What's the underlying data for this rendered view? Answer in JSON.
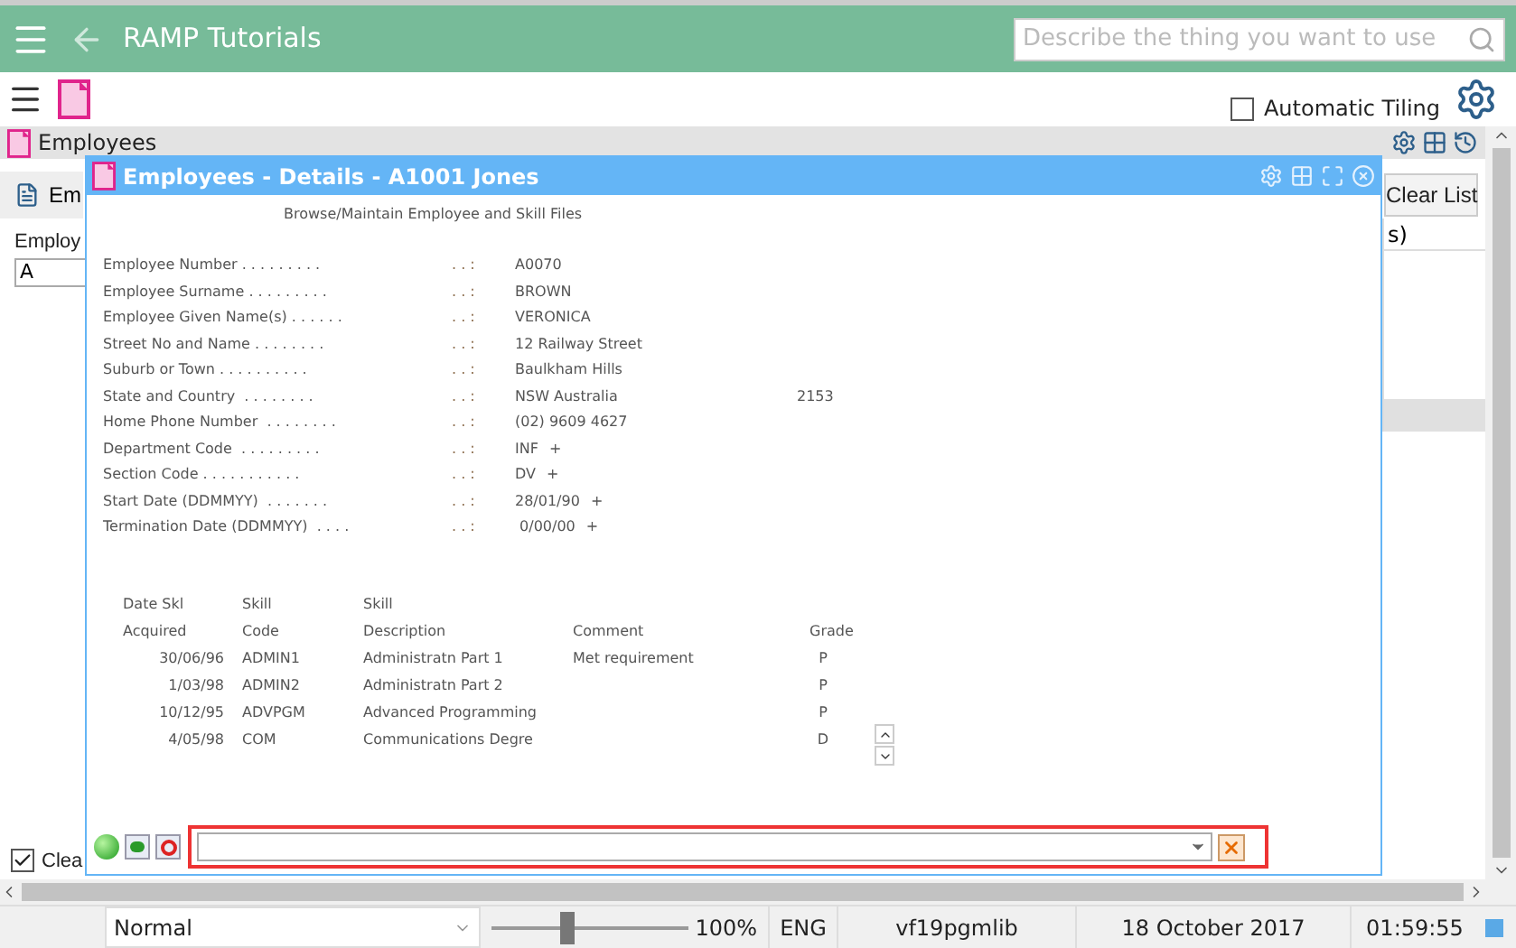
{
  "app_bar": {
    "title": "RAMP Tutorials",
    "search": {
      "placeholder": "Describe the thing you want to use"
    }
  },
  "toolbar": {
    "automatic_tiling": {
      "label": "Automatic Tiling",
      "checked": false
    }
  },
  "employees_panel": {
    "title": "Employees",
    "tab_label": "Em",
    "clear_list": "Clear List",
    "field_label": "Employ",
    "field_value": "A",
    "column_header": "s)",
    "clear_checkbox": {
      "label": "Clea",
      "checked": true
    }
  },
  "details_window": {
    "title": "Employees - Details - A1001 Jones",
    "subtitle": "Browse/Maintain Employee and Skill Files",
    "fields": [
      {
        "label": "Employee Number . . . . . . . . .",
        "separator": ". . :",
        "value": "A0070"
      },
      {
        "label": "Employee Surname . . . . . . . . .",
        "separator": ". . :",
        "value": "BROWN"
      },
      {
        "label": "Employee Given Name(s) . . . . . .",
        "separator": ". . :",
        "value": "VERONICA"
      },
      {
        "label": "Street No and Name . . . . . . . .",
        "separator": ". . :",
        "value": "12 Railway Street"
      },
      {
        "label": "Suburb or Town . . . . . . . . . .",
        "separator": ". . :",
        "value": "Baulkham Hills"
      },
      {
        "label": "State and Country  . . . . . . . .",
        "separator": ". . :",
        "value": "NSW Australia",
        "extra": "2153"
      },
      {
        "label": "Home Phone Number  . . . . . . . .",
        "separator": ". . :",
        "value": "(02) 9609 4627"
      },
      {
        "label": "Department Code  . . . . . . . . .",
        "separator": ". . :",
        "value": "INF",
        "extra": "+"
      },
      {
        "label": "Section Code . . . . . . . . . . .",
        "separator": ". . :",
        "value": "DV",
        "extra": "+"
      },
      {
        "label": "Start Date (DDMMYY)  . . . . . . .",
        "separator": ". . :",
        "value": "28/01/90",
        "extra": "+"
      },
      {
        "label": "Termination Date (DDMMYY)  . . . .",
        "separator": ". . :",
        "value": " 0/00/00",
        "extra": "+"
      }
    ],
    "skill_columns": [
      {
        "line_1": "Date Skl",
        "line_2": "Acquired"
      },
      {
        "line_1": "Skill",
        "line_2": "Code"
      },
      {
        "line_1": "Skill",
        "line_2": "Description"
      },
      {
        "line_2": "Comment"
      },
      {
        "line_2": "Grade"
      }
    ],
    "skills": [
      {
        "date": "30/06/96",
        "code": "ADMIN1",
        "description": "Administratn Part 1",
        "comment": "Met requirement",
        "grade": "P"
      },
      {
        "date": "1/03/98",
        "code": "ADMIN2",
        "description": "Administratn Part 2",
        "grade": "P"
      },
      {
        "date": "10/12/95",
        "code": "ADVPGM",
        "description": "Advanced Programming",
        "grade": "P"
      },
      {
        "date": "4/05/98",
        "code": "COM",
        "description": "Communications Degre",
        "grade": "D"
      }
    ]
  },
  "status_bar": {
    "mode": "Normal",
    "zoom": {
      "level": 0.39,
      "reading": "100%"
    },
    "language": "ENG",
    "library": "vf19pgmlib",
    "date": "18 October 2017",
    "time": "01:59:55"
  }
}
